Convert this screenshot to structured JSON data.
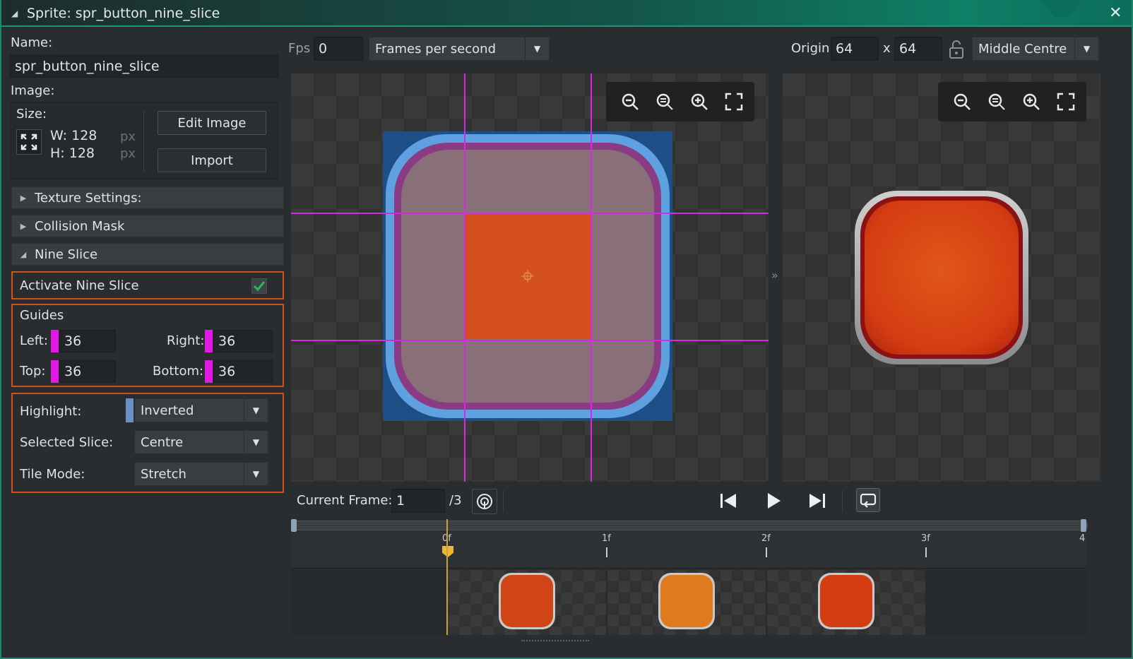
{
  "window": {
    "title": "Sprite: spr_button_nine_slice",
    "close_icon": "close-icon"
  },
  "left": {
    "name_label": "Name:",
    "name_value": "spr_button_nine_slice",
    "image_label": "Image:",
    "size_label": "Size:",
    "width_text": "W: 128",
    "height_text": "H: 128",
    "px1": "px",
    "px2": "px",
    "edit_image": "Edit Image",
    "import": "Import",
    "texture_settings": "Texture Settings:",
    "collision_mask": "Collision Mask",
    "nine_slice": "Nine Slice",
    "activate_label": "Activate Nine Slice",
    "activate_checked": true,
    "guides_label": "Guides",
    "left_label": "Left:",
    "left_value": "36",
    "right_label": "Right:",
    "right_value": "36",
    "top_label": "Top:",
    "top_value": "36",
    "bottom_label": "Bottom:",
    "bottom_value": "36",
    "highlight_label": "Highlight:",
    "highlight_value": "Inverted",
    "selected_slice_label": "Selected Slice:",
    "selected_slice_value": "Centre",
    "tile_mode_label": "Tile Mode:",
    "tile_mode_value": "Stretch"
  },
  "toolbar": {
    "fps_label": "Fps",
    "fps_value": "0",
    "fps_mode": "Frames per second",
    "origin_label": "Origin",
    "origin_x": "64",
    "x_sep": "x",
    "origin_y": "64",
    "origin_preset": "Middle Centre"
  },
  "playback": {
    "current_frame_label": "Current Frame:",
    "current_frame": "1",
    "total_frames": "/3"
  },
  "timeline": {
    "ticks": [
      "0f",
      "1f",
      "2f",
      "3f",
      "4"
    ]
  },
  "colors": {
    "accent": "#d0531e",
    "guide": "#d62ae0",
    "titlebar": "#0e7f66"
  }
}
